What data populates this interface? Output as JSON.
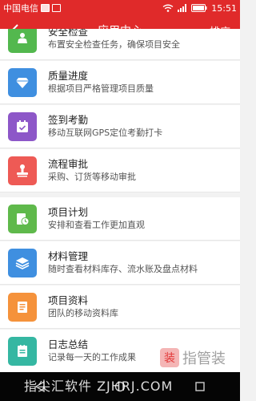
{
  "status_bar": {
    "carrier": "中国电信",
    "time": "15:51",
    "icons": [
      "notification-icon",
      "image-icon",
      "wifi-icon",
      "signal-icon",
      "battery-icon"
    ]
  },
  "nav": {
    "title": "应用中心",
    "sort_label": "排序",
    "back_icon": "chevron-left-icon"
  },
  "apps": [
    {
      "title": "安全检查",
      "desc": "布置安全检查任务，确保项目安全",
      "icon": "safety-icon",
      "color": "#53b84e"
    },
    {
      "title": "质量进度",
      "desc": "根据项目严格管理项目质量",
      "icon": "diamond-icon",
      "color": "#3f8fe0"
    },
    {
      "title": "签到考勤",
      "desc": "移动互联网GPS定位考勤打卡",
      "icon": "calendar-check-icon",
      "color": "#8d57c8"
    },
    {
      "title": "流程审批",
      "desc": "采购、订货等移动审批",
      "icon": "stamp-icon",
      "color": "#ee5a55"
    },
    {
      "title": "项目计划",
      "desc": "安排和查看工作更加直观",
      "icon": "clock-doc-icon",
      "color": "#5fb94b"
    },
    {
      "title": "材料管理",
      "desc": "随时查看材料库存、流水账及盘点材料",
      "icon": "layers-icon",
      "color": "#3f8fe0"
    },
    {
      "title": "项目资料",
      "desc": "团队的移动资料库",
      "icon": "document-icon",
      "color": "#f5923b"
    },
    {
      "title": "日志总结",
      "desc": "记录每一天的工作成果",
      "icon": "notebook-icon",
      "color": "#35b7a2"
    }
  ],
  "watermark": {
    "text": "指尖汇软件 ZJHRJ.COM",
    "logo_char": "装",
    "logo_text": "指管装"
  },
  "colors": {
    "accent": "#e02a2a",
    "bottom_bar": "#050505"
  }
}
